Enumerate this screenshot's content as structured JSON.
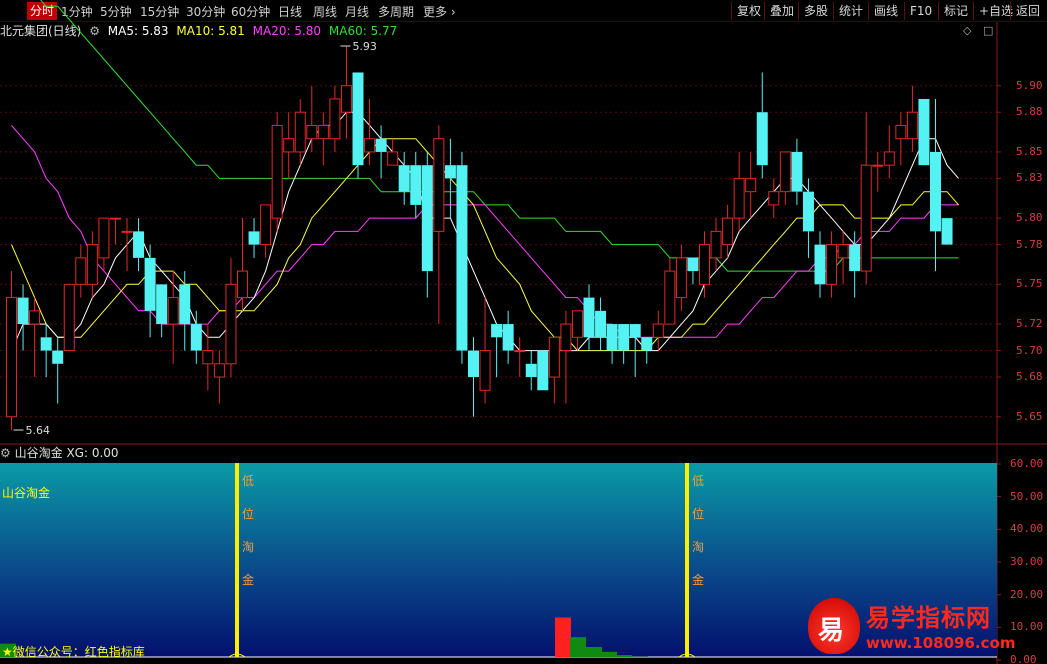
{
  "toolbar": {
    "timeframes": [
      "分时",
      "1分钟",
      "5分钟",
      "15分钟",
      "30分钟",
      "60分钟",
      "日线",
      "周线",
      "月线",
      "多周期",
      "更多"
    ],
    "active_timeframe": "分时",
    "right_buttons": [
      "复权",
      "叠加",
      "多股",
      "统计",
      "画线",
      "F10",
      "标记",
      "+自选",
      "返回"
    ]
  },
  "main_header": {
    "stock": "北元集团(日线)",
    "ma5": "MA5: 5.83",
    "ma10": "MA10: 5.81",
    "ma20": "MA20: 5.80",
    "ma60": "MA60: 5.77"
  },
  "colors": {
    "up": "#e02828",
    "down": "#54f2f2",
    "ma5": "#ffffff",
    "ma10": "#ffff3a",
    "ma20": "#ff40ff",
    "ma60": "#30e030",
    "axis": "#d24040"
  },
  "price_axis": {
    "min": 5.63,
    "max": 5.95,
    "labels": [
      "5.90",
      "5.88",
      "5.85",
      "5.83",
      "5.80",
      "5.78",
      "5.75",
      "5.72",
      "5.70",
      "5.68",
      "5.65"
    ],
    "high_marker": "5.93",
    "low_marker": "5.64"
  },
  "sub_header": {
    "name": "山谷淘金",
    "xg": "XG: 0.00"
  },
  "sub_axis": {
    "labels": [
      "60.00",
      "50.00",
      "40.00",
      "30.00",
      "20.00",
      "10.00",
      "0.00"
    ]
  },
  "sub_panel": {
    "label": "山谷淘金",
    "signal_chars": [
      "低",
      "位",
      "淘",
      "金"
    ],
    "wechat": "★微信公众号：红色指标库"
  },
  "watermark": {
    "logo_char": "易",
    "title": "易学指标网",
    "url": "www.108096.com"
  },
  "chart_data": {
    "type": "candlestick",
    "title": "北元集团(日线)",
    "candles": [
      {
        "o": 5.65,
        "h": 5.76,
        "l": 5.64,
        "c": 5.74
      },
      {
        "o": 5.74,
        "h": 5.75,
        "l": 5.7,
        "c": 5.72
      },
      {
        "o": 5.72,
        "h": 5.74,
        "l": 5.68,
        "c": 5.73
      },
      {
        "o": 5.71,
        "h": 5.72,
        "l": 5.68,
        "c": 5.7
      },
      {
        "o": 5.7,
        "h": 5.71,
        "l": 5.66,
        "c": 5.69
      },
      {
        "o": 5.7,
        "h": 5.75,
        "l": 5.7,
        "c": 5.75
      },
      {
        "o": 5.75,
        "h": 5.78,
        "l": 5.74,
        "c": 5.77
      },
      {
        "o": 5.75,
        "h": 5.79,
        "l": 5.74,
        "c": 5.78
      },
      {
        "o": 5.77,
        "h": 5.8,
        "l": 5.76,
        "c": 5.8
      },
      {
        "o": 5.8,
        "h": 5.8,
        "l": 5.78,
        "c": 5.8
      },
      {
        "o": 5.79,
        "h": 5.8,
        "l": 5.76,
        "c": 5.79
      },
      {
        "o": 5.79,
        "h": 5.8,
        "l": 5.76,
        "c": 5.77
      },
      {
        "o": 5.77,
        "h": 5.78,
        "l": 5.71,
        "c": 5.73
      },
      {
        "o": 5.75,
        "h": 5.75,
        "l": 5.71,
        "c": 5.72
      },
      {
        "o": 5.72,
        "h": 5.76,
        "l": 5.69,
        "c": 5.74
      },
      {
        "o": 5.75,
        "h": 5.76,
        "l": 5.7,
        "c": 5.72
      },
      {
        "o": 5.72,
        "h": 5.73,
        "l": 5.69,
        "c": 5.7
      },
      {
        "o": 5.69,
        "h": 5.72,
        "l": 5.67,
        "c": 5.7
      },
      {
        "o": 5.68,
        "h": 5.7,
        "l": 5.66,
        "c": 5.69
      },
      {
        "o": 5.69,
        "h": 5.77,
        "l": 5.68,
        "c": 5.75
      },
      {
        "o": 5.74,
        "h": 5.8,
        "l": 5.73,
        "c": 5.76
      },
      {
        "o": 5.79,
        "h": 5.8,
        "l": 5.77,
        "c": 5.78
      },
      {
        "o": 5.78,
        "h": 5.81,
        "l": 5.77,
        "c": 5.81
      },
      {
        "o": 5.8,
        "h": 5.88,
        "l": 5.79,
        "c": 5.87
      },
      {
        "o": 5.85,
        "h": 5.88,
        "l": 5.83,
        "c": 5.86
      },
      {
        "o": 5.85,
        "h": 5.89,
        "l": 5.84,
        "c": 5.88
      },
      {
        "o": 5.86,
        "h": 5.9,
        "l": 5.85,
        "c": 5.87
      },
      {
        "o": 5.86,
        "h": 5.88,
        "l": 5.84,
        "c": 5.87
      },
      {
        "o": 5.86,
        "h": 5.9,
        "l": 5.85,
        "c": 5.89
      },
      {
        "o": 5.88,
        "h": 5.93,
        "l": 5.86,
        "c": 5.9
      },
      {
        "o": 5.91,
        "h": 5.91,
        "l": 5.83,
        "c": 5.84
      },
      {
        "o": 5.85,
        "h": 5.89,
        "l": 5.84,
        "c": 5.86
      },
      {
        "o": 5.86,
        "h": 5.87,
        "l": 5.83,
        "c": 5.85
      },
      {
        "o": 5.84,
        "h": 5.86,
        "l": 5.84,
        "c": 5.85
      },
      {
        "o": 5.84,
        "h": 5.85,
        "l": 5.81,
        "c": 5.82
      },
      {
        "o": 5.84,
        "h": 5.85,
        "l": 5.8,
        "c": 5.81
      },
      {
        "o": 5.84,
        "h": 5.85,
        "l": 5.74,
        "c": 5.76
      },
      {
        "o": 5.79,
        "h": 5.87,
        "l": 5.72,
        "c": 5.86
      },
      {
        "o": 5.84,
        "h": 5.86,
        "l": 5.8,
        "c": 5.83
      },
      {
        "o": 5.84,
        "h": 5.85,
        "l": 5.69,
        "c": 5.7
      },
      {
        "o": 5.7,
        "h": 5.71,
        "l": 5.65,
        "c": 5.68
      },
      {
        "o": 5.67,
        "h": 5.74,
        "l": 5.66,
        "c": 5.7
      },
      {
        "o": 5.72,
        "h": 5.72,
        "l": 5.68,
        "c": 5.71
      },
      {
        "o": 5.72,
        "h": 5.73,
        "l": 5.69,
        "c": 5.7
      },
      {
        "o": 5.7,
        "h": 5.71,
        "l": 5.68,
        "c": 5.7
      },
      {
        "o": 5.69,
        "h": 5.7,
        "l": 5.67,
        "c": 5.68
      },
      {
        "o": 5.7,
        "h": 5.7,
        "l": 5.67,
        "c": 5.67
      },
      {
        "o": 5.68,
        "h": 5.71,
        "l": 5.66,
        "c": 5.71
      },
      {
        "o": 5.7,
        "h": 5.73,
        "l": 5.66,
        "c": 5.72
      },
      {
        "o": 5.71,
        "h": 5.73,
        "l": 5.7,
        "c": 5.73
      },
      {
        "o": 5.74,
        "h": 5.75,
        "l": 5.7,
        "c": 5.71
      },
      {
        "o": 5.73,
        "h": 5.74,
        "l": 5.7,
        "c": 5.71
      },
      {
        "o": 5.72,
        "h": 5.72,
        "l": 5.69,
        "c": 5.7
      },
      {
        "o": 5.72,
        "h": 5.72,
        "l": 5.69,
        "c": 5.7
      },
      {
        "o": 5.72,
        "h": 5.72,
        "l": 5.68,
        "c": 5.71
      },
      {
        "o": 5.71,
        "h": 5.71,
        "l": 5.69,
        "c": 5.7
      },
      {
        "o": 5.71,
        "h": 5.73,
        "l": 5.7,
        "c": 5.72
      },
      {
        "o": 5.72,
        "h": 5.77,
        "l": 5.72,
        "c": 5.76
      },
      {
        "o": 5.74,
        "h": 5.78,
        "l": 5.73,
        "c": 5.77
      },
      {
        "o": 5.77,
        "h": 5.77,
        "l": 5.75,
        "c": 5.76
      },
      {
        "o": 5.75,
        "h": 5.79,
        "l": 5.74,
        "c": 5.78
      },
      {
        "o": 5.77,
        "h": 5.8,
        "l": 5.76,
        "c": 5.79
      },
      {
        "o": 5.78,
        "h": 5.81,
        "l": 5.77,
        "c": 5.8
      },
      {
        "o": 5.8,
        "h": 5.85,
        "l": 5.79,
        "c": 5.83
      },
      {
        "o": 5.82,
        "h": 5.85,
        "l": 5.8,
        "c": 5.83
      },
      {
        "o": 5.88,
        "h": 5.91,
        "l": 5.83,
        "c": 5.84
      },
      {
        "o": 5.81,
        "h": 5.83,
        "l": 5.8,
        "c": 5.82
      },
      {
        "o": 5.82,
        "h": 5.85,
        "l": 5.81,
        "c": 5.85
      },
      {
        "o": 5.85,
        "h": 5.86,
        "l": 5.81,
        "c": 5.82
      },
      {
        "o": 5.82,
        "h": 5.83,
        "l": 5.77,
        "c": 5.79
      },
      {
        "o": 5.78,
        "h": 5.79,
        "l": 5.74,
        "c": 5.75
      },
      {
        "o": 5.75,
        "h": 5.79,
        "l": 5.74,
        "c": 5.78
      },
      {
        "o": 5.77,
        "h": 5.79,
        "l": 5.75,
        "c": 5.78
      },
      {
        "o": 5.78,
        "h": 5.79,
        "l": 5.74,
        "c": 5.76
      },
      {
        "o": 5.76,
        "h": 5.88,
        "l": 5.75,
        "c": 5.84
      },
      {
        "o": 5.84,
        "h": 5.85,
        "l": 5.82,
        "c": 5.84
      },
      {
        "o": 5.84,
        "h": 5.87,
        "l": 5.83,
        "c": 5.85
      },
      {
        "o": 5.86,
        "h": 5.88,
        "l": 5.84,
        "c": 5.87
      },
      {
        "o": 5.86,
        "h": 5.9,
        "l": 5.85,
        "c": 5.88
      },
      {
        "o": 5.89,
        "h": 5.89,
        "l": 5.84,
        "c": 5.84
      },
      {
        "o": 5.85,
        "h": 5.89,
        "l": 5.76,
        "c": 5.79
      },
      {
        "o": 5.8,
        "h": 5.8,
        "l": 5.78,
        "c": 5.78
      }
    ],
    "ma5": [
      5.7,
      5.72,
      5.72,
      5.72,
      5.71,
      5.71,
      5.72,
      5.74,
      5.75,
      5.77,
      5.78,
      5.79,
      5.77,
      5.76,
      5.75,
      5.74,
      5.72,
      5.71,
      5.71,
      5.72,
      5.73,
      5.74,
      5.76,
      5.79,
      5.82,
      5.84,
      5.86,
      5.87,
      5.87,
      5.88,
      5.88,
      5.87,
      5.86,
      5.85,
      5.84,
      5.83,
      5.8,
      5.8,
      5.8,
      5.78,
      5.76,
      5.74,
      5.72,
      5.71,
      5.7,
      5.7,
      5.7,
      5.7,
      5.7,
      5.7,
      5.71,
      5.71,
      5.71,
      5.71,
      5.71,
      5.7,
      5.7,
      5.71,
      5.72,
      5.73,
      5.75,
      5.76,
      5.77,
      5.79,
      5.8,
      5.81,
      5.82,
      5.83,
      5.83,
      5.82,
      5.81,
      5.8,
      5.79,
      5.78,
      5.78,
      5.79,
      5.8,
      5.82,
      5.84,
      5.86,
      5.86,
      5.84,
      5.83
    ],
    "ma10": [
      5.78,
      5.76,
      5.74,
      5.72,
      5.71,
      5.71,
      5.71,
      5.72,
      5.73,
      5.74,
      5.75,
      5.75,
      5.76,
      5.76,
      5.76,
      5.75,
      5.75,
      5.74,
      5.73,
      5.73,
      5.73,
      5.73,
      5.74,
      5.75,
      5.77,
      5.78,
      5.8,
      5.81,
      5.82,
      5.83,
      5.84,
      5.85,
      5.86,
      5.86,
      5.86,
      5.86,
      5.85,
      5.84,
      5.83,
      5.82,
      5.81,
      5.79,
      5.77,
      5.76,
      5.75,
      5.73,
      5.72,
      5.71,
      5.71,
      5.7,
      5.7,
      5.7,
      5.7,
      5.7,
      5.7,
      5.7,
      5.71,
      5.71,
      5.71,
      5.72,
      5.72,
      5.73,
      5.74,
      5.75,
      5.76,
      5.77,
      5.78,
      5.79,
      5.8,
      5.8,
      5.81,
      5.81,
      5.81,
      5.8,
      5.8,
      5.8,
      5.8,
      5.81,
      5.81,
      5.82,
      5.82,
      5.82,
      5.81
    ],
    "ma20": [
      5.87,
      5.86,
      5.85,
      5.83,
      5.82,
      5.8,
      5.79,
      5.77,
      5.76,
      5.75,
      5.74,
      5.73,
      5.73,
      5.72,
      5.72,
      5.72,
      5.72,
      5.72,
      5.73,
      5.73,
      5.74,
      5.74,
      5.75,
      5.76,
      5.76,
      5.77,
      5.78,
      5.78,
      5.79,
      5.79,
      5.79,
      5.8,
      5.8,
      5.8,
      5.8,
      5.8,
      5.81,
      5.81,
      5.81,
      5.81,
      5.81,
      5.81,
      5.8,
      5.79,
      5.78,
      5.77,
      5.76,
      5.75,
      5.74,
      5.74,
      5.73,
      5.72,
      5.72,
      5.71,
      5.71,
      5.71,
      5.71,
      5.71,
      5.71,
      5.71,
      5.71,
      5.71,
      5.72,
      5.72,
      5.73,
      5.74,
      5.74,
      5.75,
      5.76,
      5.76,
      5.77,
      5.77,
      5.78,
      5.78,
      5.79,
      5.79,
      5.79,
      5.8,
      5.8,
      5.8,
      5.81,
      5.81,
      5.81
    ],
    "ma60": [
      5.99,
      5.98,
      5.97,
      5.96,
      5.96,
      5.95,
      5.94,
      5.93,
      5.92,
      5.91,
      5.9,
      5.89,
      5.88,
      5.87,
      5.86,
      5.85,
      5.84,
      5.84,
      5.83,
      5.83,
      5.83,
      5.83,
      5.83,
      5.83,
      5.83,
      5.83,
      5.83,
      5.83,
      5.83,
      5.83,
      5.83,
      5.83,
      5.82,
      5.82,
      5.82,
      5.82,
      5.82,
      5.82,
      5.82,
      5.82,
      5.82,
      5.81,
      5.81,
      5.81,
      5.8,
      5.8,
      5.8,
      5.8,
      5.79,
      5.79,
      5.79,
      5.79,
      5.78,
      5.78,
      5.78,
      5.78,
      5.78,
      5.77,
      5.77,
      5.77,
      5.77,
      5.77,
      5.76,
      5.76,
      5.76,
      5.76,
      5.76,
      5.76,
      5.76,
      5.76,
      5.76,
      5.76,
      5.77,
      5.77,
      5.77,
      5.77,
      5.77,
      5.77,
      5.77,
      5.77,
      5.77,
      5.77,
      5.77
    ],
    "sub_indicator": {
      "name": "山谷淘金",
      "ylim": [
        0,
        60
      ],
      "signal_bars": [
        17,
        49
      ],
      "red_bars": [
        {
          "i": 40,
          "v": 13
        }
      ],
      "green_bars": [
        {
          "i": 0,
          "v": 5
        },
        {
          "i": 41,
          "v": 7
        },
        {
          "i": 42,
          "v": 4
        },
        {
          "i": 43,
          "v": 2.5
        },
        {
          "i": 44,
          "v": 1.5
        },
        {
          "i": 45,
          "v": 1
        },
        {
          "i": 46,
          "v": 0.5
        },
        {
          "i": 47,
          "v": 0.3
        }
      ]
    }
  }
}
